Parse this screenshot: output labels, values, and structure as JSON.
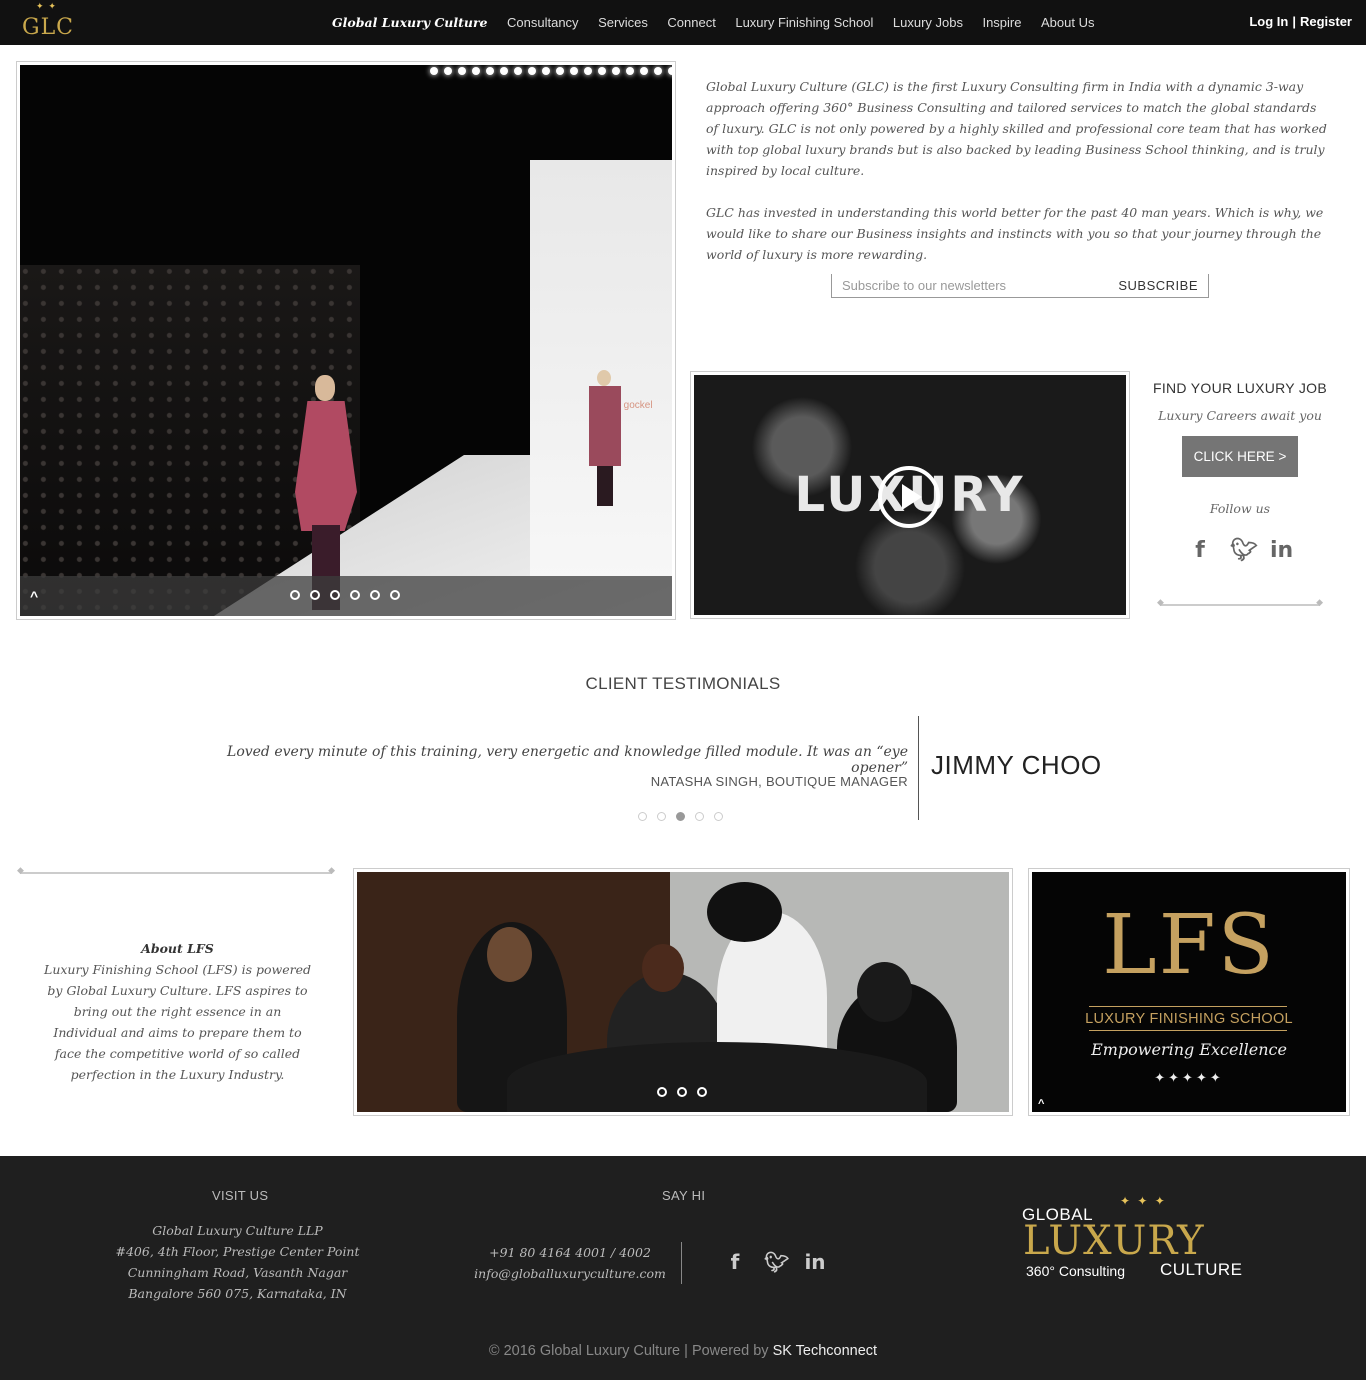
{
  "nav": {
    "logo_text": "GLC",
    "items": [
      "Global Luxury Culture",
      "Consultancy",
      "Services",
      "Connect",
      "Luxury Finishing School",
      "Luxury Jobs",
      "Inspire",
      "About Us"
    ],
    "login": "Log In",
    "separator": "|",
    "register": "Register"
  },
  "hero": {
    "brand_on_wall": "anja gockel",
    "up_arrow": "^",
    "slide_count": 6
  },
  "intro": {
    "paragraph1": "Global Luxury Culture (GLC) is the first Luxury Consulting firm in India with a dynamic 3-way approach offering 360° Business Consulting and tailored services to match the global standards of luxury. GLC is not only powered by a highly skilled and professional core team that has worked with top global luxury brands but is also backed by leading Business School thinking, and is truly inspired by local culture.",
    "paragraph2": "GLC has invested in understanding this world better for the past 40 man years. Which is why, we would like to share our Business insights and instincts with you so that your journey through the world of luxury is more rewarding."
  },
  "newsletter": {
    "placeholder": "Subscribe to our newsletters",
    "button": "SUBSCRIBE"
  },
  "video": {
    "word": "LUXURY",
    "play_icon": "play-icon"
  },
  "jobs": {
    "heading": "FIND YOUR LUXURY JOB",
    "subheading": "Luxury Careers await you",
    "button": "CLICK HERE >",
    "follow": "Follow us",
    "social": [
      "f",
      "t",
      "in"
    ]
  },
  "testimonials": {
    "title": "CLIENT TESTIMONIALS",
    "quote": "Loved every minute of this training, very energetic and knowledge filled module. It was an “eye opener”",
    "author": "NATASHA SINGH, BOUTIQUE MANAGER",
    "client": "JIMMY CHOO",
    "dot_count": 5,
    "active_dot": 3
  },
  "about_lfs": {
    "title": "About LFS",
    "text": "Luxury Finishing School (LFS) is powered by Global Luxury Culture. LFS aspires to bring out the right essence in an Individual and aims to prepare them to face the competitive world of so called perfection in the Luxury Industry."
  },
  "lfs_logo": {
    "big": "LFS",
    "sub": "LUXURY FINISHING SCHOOL",
    "tagline": "Empowering Excellence",
    "stars": "✦✦✦✦✦",
    "up_arrow": "^"
  },
  "footer": {
    "visit_title": "VISIT US",
    "address": [
      "Global Luxury Culture LLP",
      "#406, 4th Floor, Prestige Center Point",
      "Cunningham Road, Vasanth Nagar",
      "Bangalore 560 075, Karnataka, IN"
    ],
    "sayhi_title": "SAY HI",
    "phone": "+91 80 4164 4001 / 4002",
    "email": "info@globalluxuryculture.com",
    "social": [
      "f",
      "t",
      "in"
    ],
    "logo": {
      "global": "GLOBAL",
      "luxury": "LUXURY",
      "consulting": "360° Consulting",
      "culture": "CULTURE"
    },
    "copyright": "© 2016 Global Luxury Culture | Powered by",
    "powered_link": "SK Techconnect"
  },
  "colors": {
    "nav_bg": "#111111",
    "gold": "#c5a160",
    "footer_bg": "#1f1f1f",
    "button_grey": "#757575"
  }
}
